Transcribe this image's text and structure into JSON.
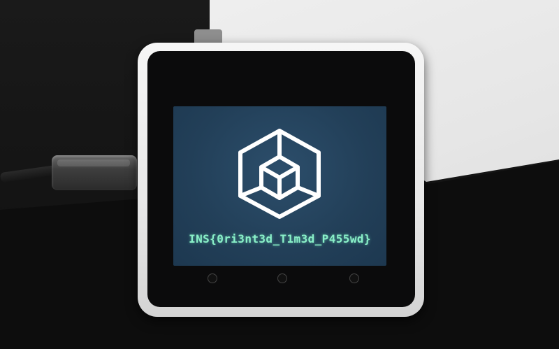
{
  "device_screen": {
    "logo_icon": "hypercube-logo-icon",
    "flag_text": "INS{0ri3nt3d_T1m3d_P455wd}",
    "colors": {
      "screen_background": "#223f58",
      "logo_stroke": "#ffffff",
      "flag_text": "#8af0c8"
    }
  },
  "device": {
    "button_count": 3,
    "frame_color": "#eeeeee"
  }
}
